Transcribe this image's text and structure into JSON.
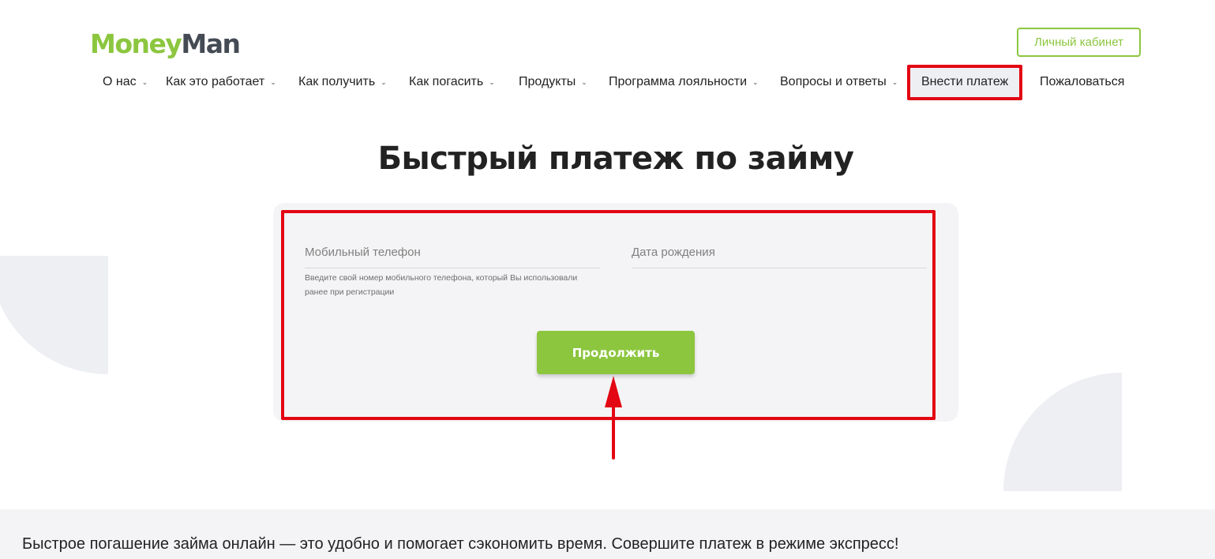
{
  "brand": {
    "part1": "Money",
    "part2": "Man",
    "accent_color": "#8cc63f",
    "dark_color": "#444b54"
  },
  "header": {
    "cabinet_label": "Личный кабинет"
  },
  "nav": {
    "items": [
      {
        "label": "О нас",
        "has_dropdown": true
      },
      {
        "label": "Как это работает",
        "has_dropdown": true
      },
      {
        "label": "Как получить",
        "has_dropdown": true
      },
      {
        "label": "Как погасить",
        "has_dropdown": true
      },
      {
        "label": "Продукты",
        "has_dropdown": true
      },
      {
        "label": "Программа лояльности",
        "has_dropdown": true
      },
      {
        "label": "Вопросы и ответы",
        "has_dropdown": true
      },
      {
        "label": "Внести платеж",
        "has_dropdown": false,
        "active": true
      },
      {
        "label": "Пожаловаться",
        "has_dropdown": false
      }
    ],
    "dropdown_icon": "chevron-down-icon"
  },
  "main": {
    "title": "Быстрый платеж по займу",
    "form": {
      "phone": {
        "placeholder": "Мобильный телефон",
        "hint": "Введите свой номер мобильного телефона, который Вы использовали ранее при регистрации"
      },
      "dob": {
        "placeholder": "Дата рождения"
      },
      "submit_label": "Продолжить"
    }
  },
  "footer": {
    "promo_text": "Быстрое погашение займа онлайн — это удобно и помогает сэкономить время. Совершите платеж в режиме экспресс!"
  },
  "annotation_color": "#e30613"
}
